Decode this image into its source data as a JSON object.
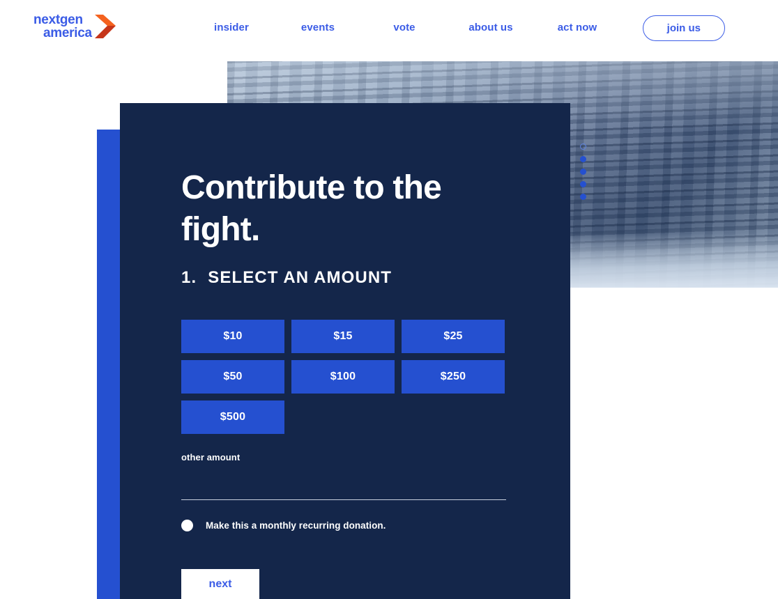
{
  "header": {
    "brand": {
      "line1": "nextgen",
      "line2": "america",
      "icon": "chevron-right-logo-icon",
      "word_color": "#3b5ce6",
      "chevron_color": "#e8491d"
    },
    "nav_items": [
      {
        "label": "insider"
      },
      {
        "label": "events"
      },
      {
        "label": "vote"
      },
      {
        "label": "about us"
      },
      {
        "label": "act now"
      }
    ],
    "cta": {
      "label": "join us"
    }
  },
  "hero": {
    "image_alt": "glacier ice cliff photograph",
    "carousel": {
      "dots": [
        {
          "state": "hollow"
        },
        {
          "state": "filled"
        },
        {
          "state": "filled"
        },
        {
          "state": "filled"
        },
        {
          "state": "filled"
        }
      ]
    }
  },
  "donate": {
    "title": "Contribute to the fight.",
    "step_number": "1.",
    "step_label": "SELECT AN AMOUNT",
    "amounts": [
      {
        "label": "$10",
        "value": "10"
      },
      {
        "label": "$15",
        "value": "15"
      },
      {
        "label": "$25",
        "value": "25"
      },
      {
        "label": "$50",
        "value": "50"
      },
      {
        "label": "$100",
        "value": "100"
      },
      {
        "label": "$250",
        "value": "250"
      },
      {
        "label": "$500",
        "value": "500"
      }
    ],
    "other_amount": {
      "label": "other amount",
      "value": "",
      "placeholder": ""
    },
    "recurring": {
      "label": "Make this a monthly recurring donation.",
      "checked": false
    },
    "next_label": "next"
  },
  "colors": {
    "panel_navy": "#14264a",
    "accent_blue": "#2550d0",
    "link_blue": "#3b5ce6",
    "white": "#ffffff",
    "logo_orange": "#e8491d"
  }
}
